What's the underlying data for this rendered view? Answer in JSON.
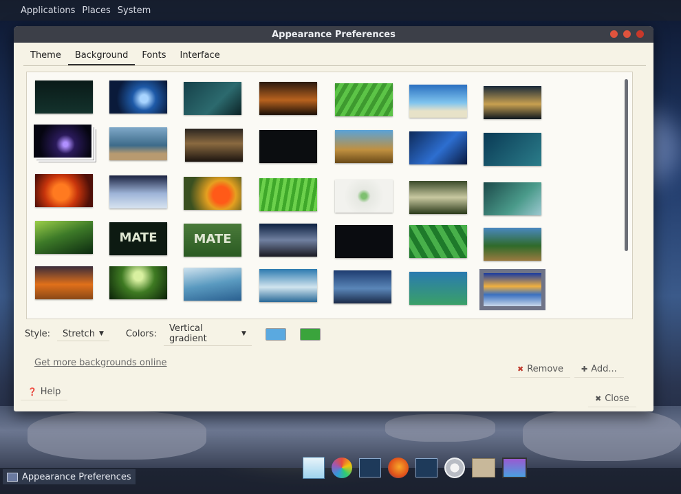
{
  "top_panel": {
    "applications": "Applications",
    "places": "Places",
    "system": "System"
  },
  "window": {
    "title": "Appearance Preferences",
    "tabs": [
      {
        "label": "Theme"
      },
      {
        "label": "Background",
        "active": true
      },
      {
        "label": "Fonts"
      },
      {
        "label": "Interface"
      }
    ],
    "mate_text": "MATE",
    "style_label": "Style:",
    "style_value": "Stretch",
    "colors_label": "Colors:",
    "colors_value": "Vertical gradient",
    "color_primary": "#5aa9e0",
    "color_secondary": "#3aa43c",
    "more_link": "Get more backgrounds online",
    "remove_label": "Remove",
    "add_label": "Add...",
    "help_label": "Help",
    "close_label": "Close"
  },
  "taskbar": {
    "window_label": "Appearance Preferences"
  }
}
